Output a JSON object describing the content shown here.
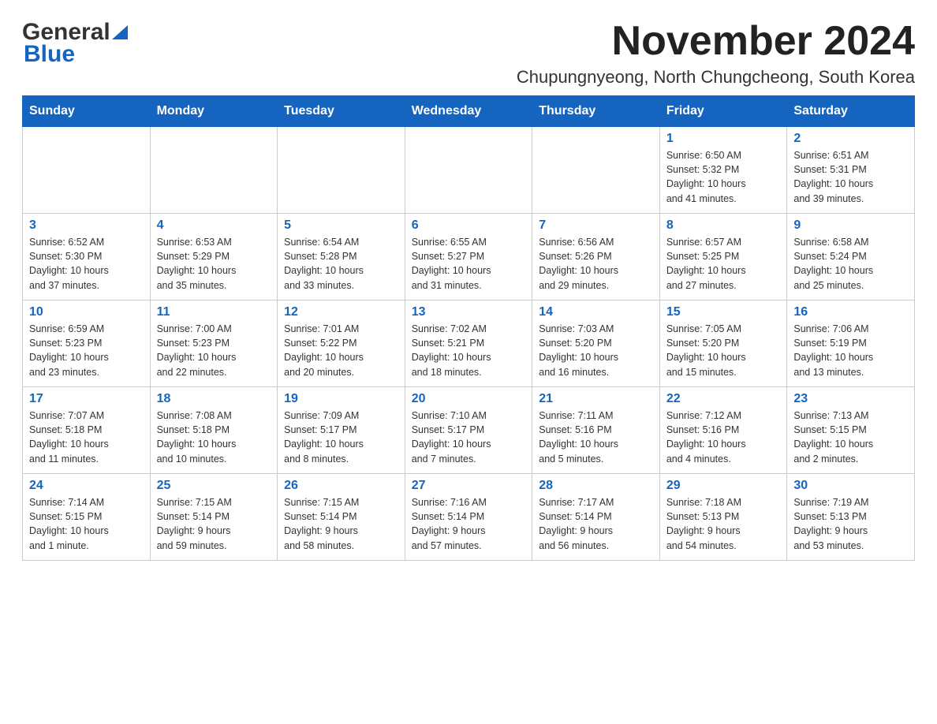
{
  "logo": {
    "general": "General",
    "blue": "Blue",
    "arrow_color": "#1565c0"
  },
  "header": {
    "month_year": "November 2024",
    "location": "Chupungnyeong, North Chungcheong, South Korea"
  },
  "weekdays": [
    "Sunday",
    "Monday",
    "Tuesday",
    "Wednesday",
    "Thursday",
    "Friday",
    "Saturday"
  ],
  "weeks": [
    {
      "days": [
        {
          "number": "",
          "info": ""
        },
        {
          "number": "",
          "info": ""
        },
        {
          "number": "",
          "info": ""
        },
        {
          "number": "",
          "info": ""
        },
        {
          "number": "",
          "info": ""
        },
        {
          "number": "1",
          "info": "Sunrise: 6:50 AM\nSunset: 5:32 PM\nDaylight: 10 hours\nand 41 minutes."
        },
        {
          "number": "2",
          "info": "Sunrise: 6:51 AM\nSunset: 5:31 PM\nDaylight: 10 hours\nand 39 minutes."
        }
      ]
    },
    {
      "days": [
        {
          "number": "3",
          "info": "Sunrise: 6:52 AM\nSunset: 5:30 PM\nDaylight: 10 hours\nand 37 minutes."
        },
        {
          "number": "4",
          "info": "Sunrise: 6:53 AM\nSunset: 5:29 PM\nDaylight: 10 hours\nand 35 minutes."
        },
        {
          "number": "5",
          "info": "Sunrise: 6:54 AM\nSunset: 5:28 PM\nDaylight: 10 hours\nand 33 minutes."
        },
        {
          "number": "6",
          "info": "Sunrise: 6:55 AM\nSunset: 5:27 PM\nDaylight: 10 hours\nand 31 minutes."
        },
        {
          "number": "7",
          "info": "Sunrise: 6:56 AM\nSunset: 5:26 PM\nDaylight: 10 hours\nand 29 minutes."
        },
        {
          "number": "8",
          "info": "Sunrise: 6:57 AM\nSunset: 5:25 PM\nDaylight: 10 hours\nand 27 minutes."
        },
        {
          "number": "9",
          "info": "Sunrise: 6:58 AM\nSunset: 5:24 PM\nDaylight: 10 hours\nand 25 minutes."
        }
      ]
    },
    {
      "days": [
        {
          "number": "10",
          "info": "Sunrise: 6:59 AM\nSunset: 5:23 PM\nDaylight: 10 hours\nand 23 minutes."
        },
        {
          "number": "11",
          "info": "Sunrise: 7:00 AM\nSunset: 5:23 PM\nDaylight: 10 hours\nand 22 minutes."
        },
        {
          "number": "12",
          "info": "Sunrise: 7:01 AM\nSunset: 5:22 PM\nDaylight: 10 hours\nand 20 minutes."
        },
        {
          "number": "13",
          "info": "Sunrise: 7:02 AM\nSunset: 5:21 PM\nDaylight: 10 hours\nand 18 minutes."
        },
        {
          "number": "14",
          "info": "Sunrise: 7:03 AM\nSunset: 5:20 PM\nDaylight: 10 hours\nand 16 minutes."
        },
        {
          "number": "15",
          "info": "Sunrise: 7:05 AM\nSunset: 5:20 PM\nDaylight: 10 hours\nand 15 minutes."
        },
        {
          "number": "16",
          "info": "Sunrise: 7:06 AM\nSunset: 5:19 PM\nDaylight: 10 hours\nand 13 minutes."
        }
      ]
    },
    {
      "days": [
        {
          "number": "17",
          "info": "Sunrise: 7:07 AM\nSunset: 5:18 PM\nDaylight: 10 hours\nand 11 minutes."
        },
        {
          "number": "18",
          "info": "Sunrise: 7:08 AM\nSunset: 5:18 PM\nDaylight: 10 hours\nand 10 minutes."
        },
        {
          "number": "19",
          "info": "Sunrise: 7:09 AM\nSunset: 5:17 PM\nDaylight: 10 hours\nand 8 minutes."
        },
        {
          "number": "20",
          "info": "Sunrise: 7:10 AM\nSunset: 5:17 PM\nDaylight: 10 hours\nand 7 minutes."
        },
        {
          "number": "21",
          "info": "Sunrise: 7:11 AM\nSunset: 5:16 PM\nDaylight: 10 hours\nand 5 minutes."
        },
        {
          "number": "22",
          "info": "Sunrise: 7:12 AM\nSunset: 5:16 PM\nDaylight: 10 hours\nand 4 minutes."
        },
        {
          "number": "23",
          "info": "Sunrise: 7:13 AM\nSunset: 5:15 PM\nDaylight: 10 hours\nand 2 minutes."
        }
      ]
    },
    {
      "days": [
        {
          "number": "24",
          "info": "Sunrise: 7:14 AM\nSunset: 5:15 PM\nDaylight: 10 hours\nand 1 minute."
        },
        {
          "number": "25",
          "info": "Sunrise: 7:15 AM\nSunset: 5:14 PM\nDaylight: 9 hours\nand 59 minutes."
        },
        {
          "number": "26",
          "info": "Sunrise: 7:15 AM\nSunset: 5:14 PM\nDaylight: 9 hours\nand 58 minutes."
        },
        {
          "number": "27",
          "info": "Sunrise: 7:16 AM\nSunset: 5:14 PM\nDaylight: 9 hours\nand 57 minutes."
        },
        {
          "number": "28",
          "info": "Sunrise: 7:17 AM\nSunset: 5:14 PM\nDaylight: 9 hours\nand 56 minutes."
        },
        {
          "number": "29",
          "info": "Sunrise: 7:18 AM\nSunset: 5:13 PM\nDaylight: 9 hours\nand 54 minutes."
        },
        {
          "number": "30",
          "info": "Sunrise: 7:19 AM\nSunset: 5:13 PM\nDaylight: 9 hours\nand 53 minutes."
        }
      ]
    }
  ]
}
